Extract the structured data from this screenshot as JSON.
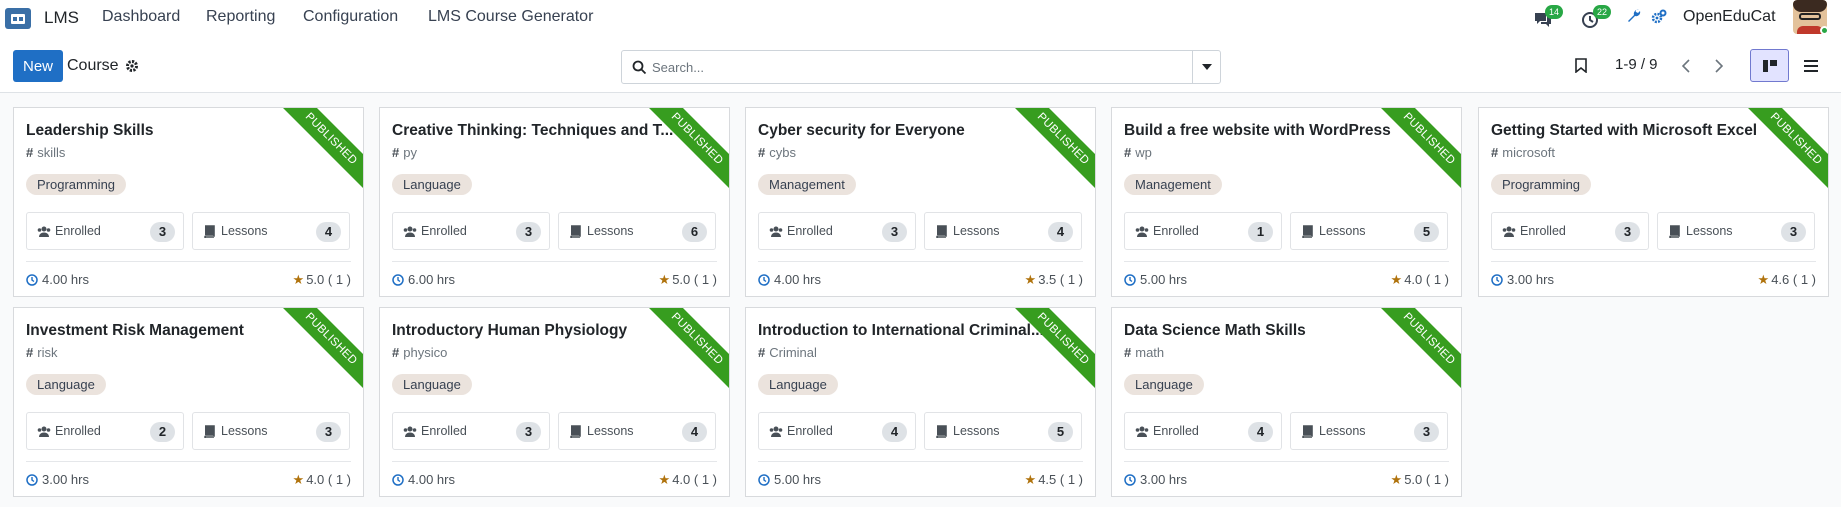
{
  "navbar": {
    "app_name": "LMS",
    "menus": [
      "Dashboard",
      "Reporting",
      "Configuration",
      "LMS Course Generator"
    ],
    "chat_badge": "14",
    "activity_badge": "22",
    "company": "OpenEduCat",
    "accent_color": "#1f6fc5",
    "badge_color": "#28a745"
  },
  "control": {
    "new_label": "New",
    "breadcrumb": "Course",
    "search_placeholder": "Search...",
    "pager": "1-9 / 9"
  },
  "ribbon_color": "#379d1f",
  "cards": [
    {
      "title": "Leadership Skills",
      "code": "skills",
      "tag": "Programming",
      "enrolled_label": "Enrolled",
      "enrolled": "3",
      "lessons_label": "Lessons",
      "lessons": "4",
      "duration": "4.00 hrs",
      "rating": "5.0 ( 1 )",
      "ribbon": "PUBLISHED"
    },
    {
      "title": "Creative Thinking: Techniques and T...",
      "code": "py",
      "tag": "Language",
      "enrolled_label": "Enrolled",
      "enrolled": "3",
      "lessons_label": "Lessons",
      "lessons": "6",
      "duration": "6.00 hrs",
      "rating": "5.0 ( 1 )",
      "ribbon": "PUBLISHED"
    },
    {
      "title": "Cyber security for Everyone",
      "code": "cybs",
      "tag": "Management",
      "enrolled_label": "Enrolled",
      "enrolled": "3",
      "lessons_label": "Lessons",
      "lessons": "4",
      "duration": "4.00 hrs",
      "rating": "3.5 ( 1 )",
      "ribbon": "PUBLISHED"
    },
    {
      "title": "Build a free website with WordPress",
      "code": "wp",
      "tag": "Management",
      "enrolled_label": "Enrolled",
      "enrolled": "1",
      "lessons_label": "Lessons",
      "lessons": "5",
      "duration": "5.00 hrs",
      "rating": "4.0 ( 1 )",
      "ribbon": "PUBLISHED"
    },
    {
      "title": "Getting Started with Microsoft Excel",
      "code": "microsoft",
      "tag": "Programming",
      "enrolled_label": "Enrolled",
      "enrolled": "3",
      "lessons_label": "Lessons",
      "lessons": "3",
      "duration": "3.00 hrs",
      "rating": "4.6 ( 1 )",
      "ribbon": "PUBLISHED"
    },
    {
      "title": "Investment Risk Management",
      "code": "risk",
      "tag": "Language",
      "enrolled_label": "Enrolled",
      "enrolled": "2",
      "lessons_label": "Lessons",
      "lessons": "3",
      "duration": "3.00 hrs",
      "rating": "4.0 ( 1 )",
      "ribbon": "PUBLISHED"
    },
    {
      "title": "Introductory Human Physiology",
      "code": "physico",
      "tag": "Language",
      "enrolled_label": "Enrolled",
      "enrolled": "3",
      "lessons_label": "Lessons",
      "lessons": "4",
      "duration": "4.00 hrs",
      "rating": "4.0 ( 1 )",
      "ribbon": "PUBLISHED"
    },
    {
      "title": "Introduction to International Criminal...",
      "code": "Criminal",
      "tag": "Language",
      "enrolled_label": "Enrolled",
      "enrolled": "4",
      "lessons_label": "Lessons",
      "lessons": "5",
      "duration": "5.00 hrs",
      "rating": "4.5 ( 1 )",
      "ribbon": "PUBLISHED"
    },
    {
      "title": "Data Science Math Skills",
      "code": "math",
      "tag": "Language",
      "enrolled_label": "Enrolled",
      "enrolled": "4",
      "lessons_label": "Lessons",
      "lessons": "3",
      "duration": "3.00 hrs",
      "rating": "5.0 ( 1 )",
      "ribbon": "PUBLISHED"
    }
  ]
}
